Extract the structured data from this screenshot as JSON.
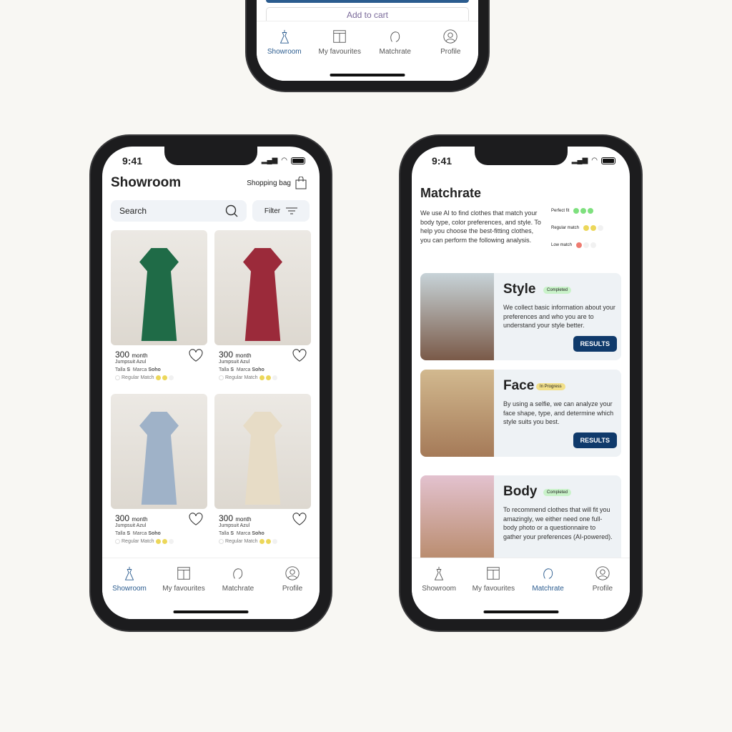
{
  "top_phone": {
    "add_to_cart": "Add to cart"
  },
  "tabs": [
    "Showroom",
    "My favourites",
    "Matchrate",
    "Profile"
  ],
  "status_time": "9:41",
  "showroom": {
    "title": "Showroom",
    "bag": "Shopping bag",
    "search_placeholder": "Search",
    "filter": "Filter",
    "products": [
      {
        "price": "300",
        "unit": "month",
        "name": "Jumpsuit Azul",
        "talla_label": "Talla",
        "talla": "S",
        "marca_label": "Marca",
        "marca": "Soho",
        "match": "Regular Match",
        "color": "#1f6b47"
      },
      {
        "price": "300",
        "unit": "month",
        "name": "Jumpsuit Azul",
        "talla_label": "Talla",
        "talla": "S",
        "marca_label": "Marca",
        "marca": "Soho",
        "match": "Regular Match",
        "color": "#9b2a3a"
      },
      {
        "price": "300",
        "unit": "month",
        "name": "Jumpsuit Azul",
        "talla_label": "Talla",
        "talla": "S",
        "marca_label": "Marca",
        "marca": "Soho",
        "match": "Regular Match",
        "color": "#9fb2c8"
      },
      {
        "price": "300",
        "unit": "month",
        "name": "Jumpsuit Azul",
        "talla_label": "Talla",
        "talla": "S",
        "marca_label": "Marca",
        "marca": "Soho",
        "match": "Regular Match",
        "color": "#e7dcc6"
      }
    ]
  },
  "matchrate": {
    "title": "Matchrate",
    "intro": "We use AI to find clothes that match your body type, color preferences, and style. To help you choose the best-fitting clothes, you can perform the following analysis.",
    "legend": [
      {
        "label": "Perfect fit",
        "color": "#7ee07e",
        "filled": 3
      },
      {
        "label": "Regular match",
        "color": "#ecd75a",
        "filled": 2
      },
      {
        "label": "Low match",
        "color": "#ee7b70",
        "filled": 1
      }
    ],
    "cards": [
      {
        "title": "Style",
        "status": "Completed",
        "desc": "We collect basic information about your preferences and who you are to understand your style better.",
        "button": "RESULTS"
      },
      {
        "title": "Face",
        "status": "In Progress",
        "desc": "By using a selfie, we can analyze your face shape, type, and determine which style suits you best.",
        "button": "RESULTS"
      },
      {
        "title": "Body",
        "status": "Completed",
        "desc": "To recommend clothes that will fit you amazingly, we either need one full-body photo or a questionnaire to gather your preferences (AI-powered)."
      }
    ]
  },
  "colors": {
    "accent": "#2b5c8f",
    "button": "#0f3a6b",
    "completed": "#c9f2c9",
    "in_progress": "#f2e08a"
  }
}
